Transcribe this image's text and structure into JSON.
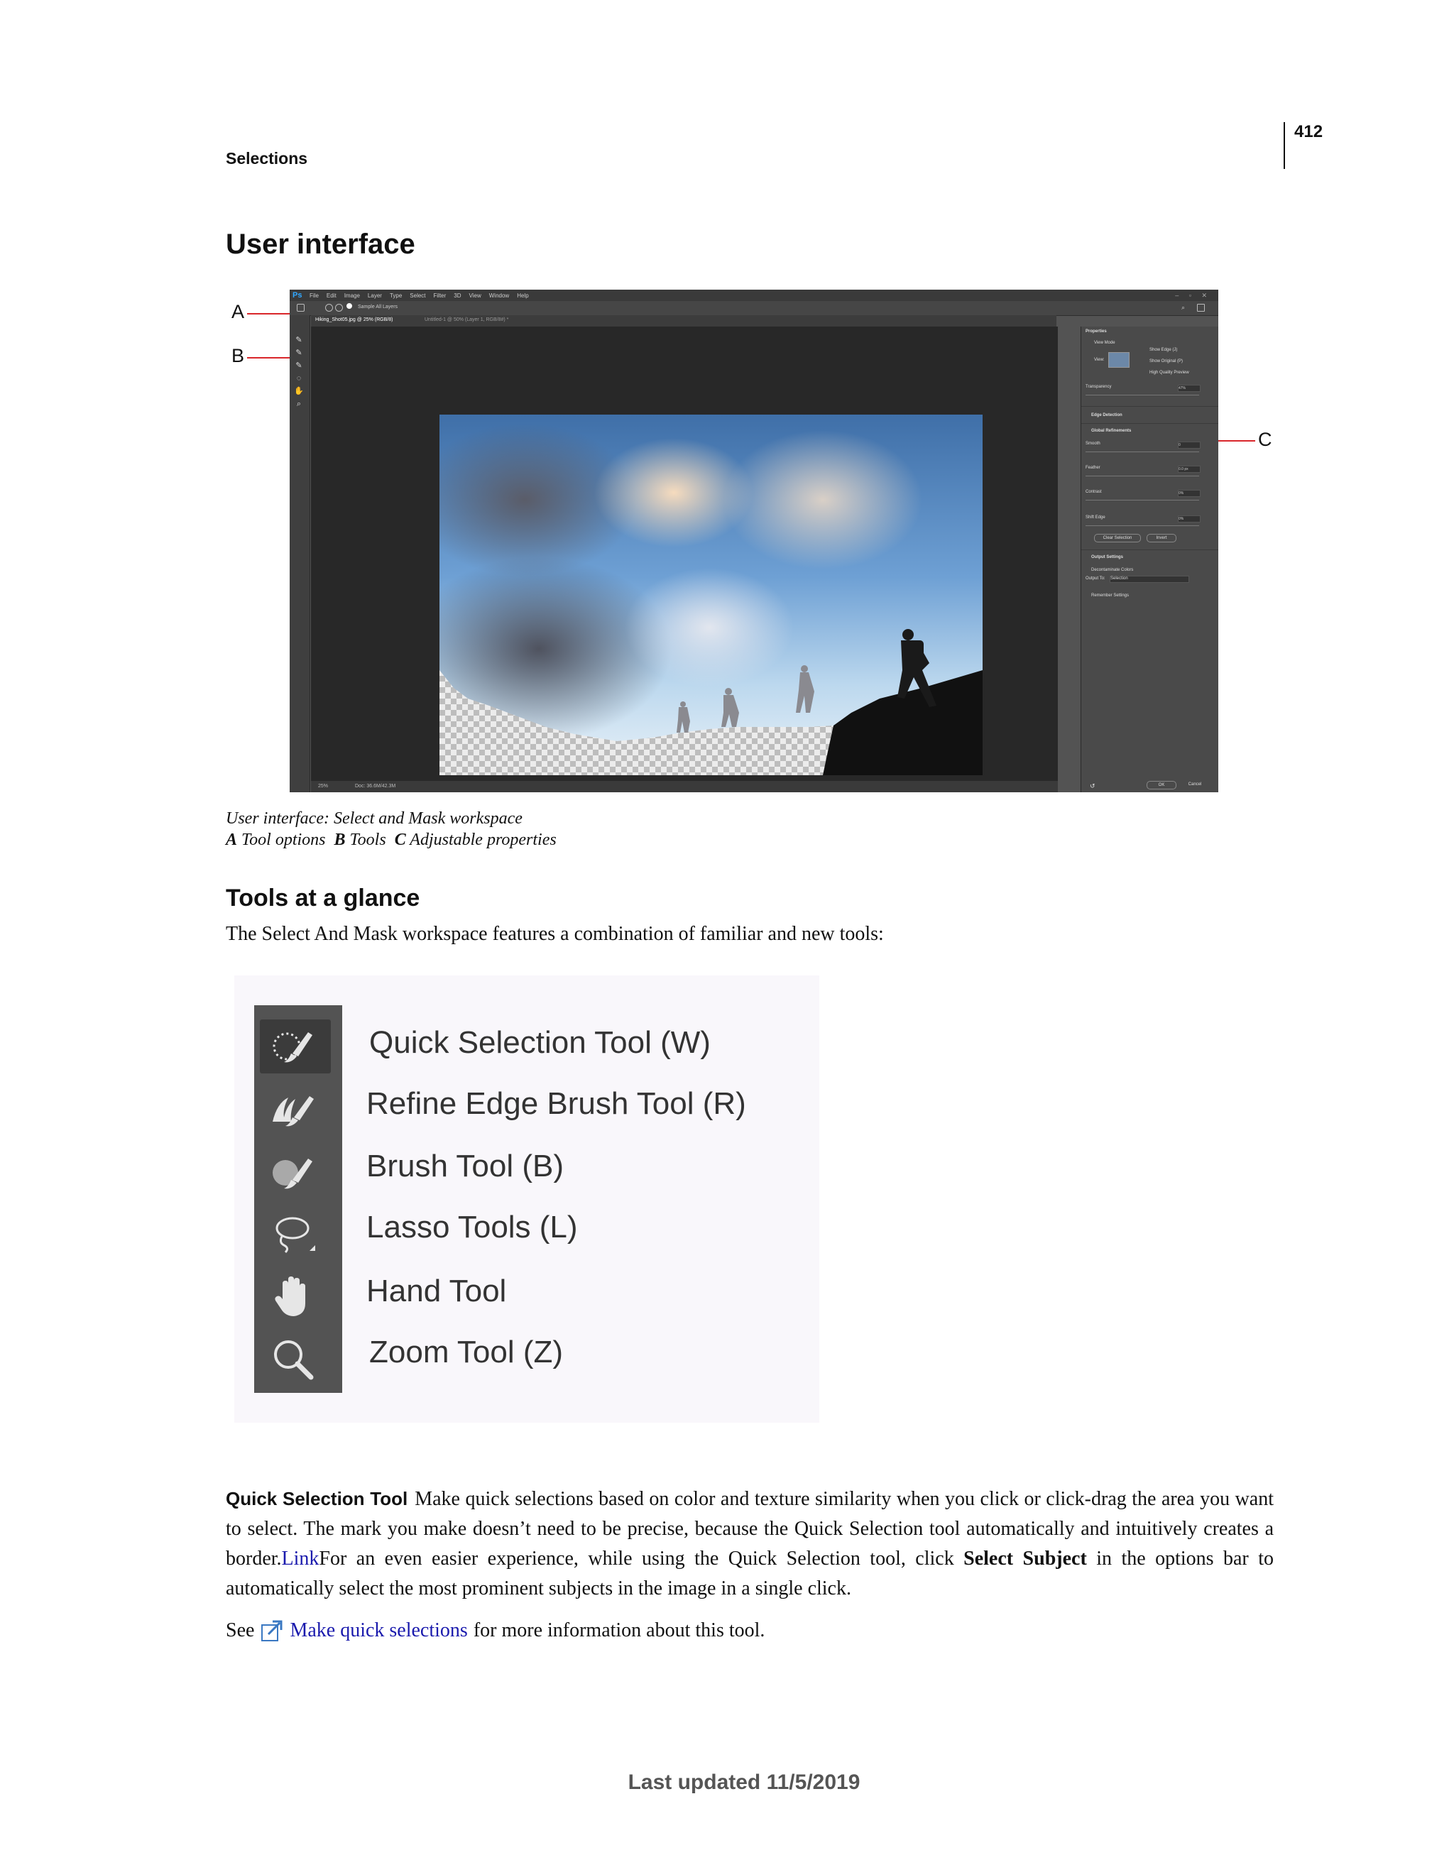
{
  "header": {
    "running_head": "Selections",
    "page_number": "412"
  },
  "section_title": "User interface",
  "screenshot": {
    "app_logo": "Ps",
    "menu": [
      "File",
      "Edit",
      "Image",
      "Layer",
      "Type",
      "Select",
      "Filter",
      "3D",
      "View",
      "Window",
      "Help"
    ],
    "window_controls": "– ▫ ✕",
    "options_sample": "Sample All Layers",
    "tabs": [
      "Hiking_Shot05.jpg @ 25% (RGB/8)",
      "Untitled-1 @ 50% (Layer 1, RGB/8#) *"
    ],
    "status_zoom": "25%",
    "status_doc": "Doc: 36.6M/42.3M",
    "properties": {
      "panel_tab": "Properties",
      "view_mode": "View Mode",
      "view": "View:",
      "show_edge": "Show Edge (J)",
      "show_original": "Show Original (P)",
      "high_quality": "High Quality Preview",
      "transparency": "Transparency",
      "transparency_val": "47%",
      "edge_detection": "Edge Detection",
      "global_refinements": "Global Refinements",
      "smooth": "Smooth",
      "smooth_val": "0",
      "feather": "Feather",
      "feather_val": "0.0 px",
      "contrast": "Contrast",
      "contrast_val": "0%",
      "shift_edge": "Shift Edge",
      "shift_edge_val": "0%",
      "clear_selection": "Clear Selection",
      "invert": "Invert",
      "output_settings": "Output Settings",
      "decontaminate": "Decontaminate Colors",
      "output_to": "Output To:",
      "output_to_val": "Selection",
      "remember": "Remember Settings",
      "ok": "OK",
      "cancel": "Cancel"
    }
  },
  "callouts": [
    "A",
    "B",
    "C"
  ],
  "caption": {
    "line1": "User interface: Select and Mask workspace",
    "a_letter": "A",
    "a_text": "Tool options",
    "b_letter": "B",
    "b_text": "Tools",
    "c_letter": "C",
    "c_text": "Adjustable properties"
  },
  "subsection_title": "Tools at a glance",
  "intro": "The Select And Mask workspace features a combination of familiar and new tools:",
  "tools": [
    {
      "label": "Quick Selection Tool (W)",
      "icon": "quick-selection-icon"
    },
    {
      "label": "Refine Edge Brush Tool (R)",
      "icon": "refine-edge-brush-icon"
    },
    {
      "label": "Brush Tool (B)",
      "icon": "brush-icon"
    },
    {
      "label": "Lasso Tools (L)",
      "icon": "lasso-icon"
    },
    {
      "label": "Hand Tool",
      "icon": "hand-icon"
    },
    {
      "label": "Zoom Tool (Z)",
      "icon": "zoom-icon"
    }
  ],
  "quick_selection": {
    "term": "Quick Selection Tool",
    "text1": "Make quick selections based on color and texture similarity when you click or click-drag the area you want to select. The mark you make doesn’t need to be precise, because the Quick Selection tool automatically and intuitively creates a border.",
    "link": "Link",
    "text2": "For an even easier experience, while using the Quick Selection tool, click ",
    "bold": "Select Subject",
    "text3": " in the options bar to automatically select the most prominent subjects in the image in a single click."
  },
  "see": {
    "prefix": "See",
    "link": "Make quick selections",
    "suffix": "for more information about this tool."
  },
  "footer": "Last updated 11/5/2019"
}
